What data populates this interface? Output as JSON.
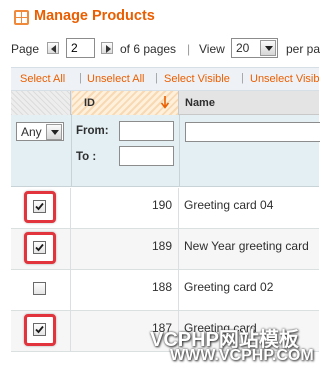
{
  "header": {
    "title": "Manage Products",
    "icon": "grid-icon"
  },
  "pager": {
    "page_label": "Page",
    "page_value": "2",
    "of_pages": "of 6 pages",
    "separator": "|",
    "view_label": "View",
    "limit_value": "20",
    "per_page": "per pa"
  },
  "massaction": {
    "select_all": "Select All",
    "unselect_all": "Unselect All",
    "select_visible": "Select Visible",
    "unselect_visible": "Unselect Visib",
    "separator": "|"
  },
  "grid": {
    "columns": {
      "id": "ID",
      "name": "Name"
    },
    "filters": {
      "any": "Any",
      "from": "From:",
      "to": "To :"
    },
    "rows": [
      {
        "id": "190",
        "name": "Greeting card 04",
        "checked": true,
        "highlighted": true
      },
      {
        "id": "189",
        "name": "New Year greeting card",
        "checked": true,
        "highlighted": true
      },
      {
        "id": "188",
        "name": "Greeting card 02",
        "checked": false,
        "highlighted": false
      },
      {
        "id": "187",
        "name": "Greeting card",
        "checked": true,
        "highlighted": true
      }
    ]
  },
  "watermark": {
    "line1": "VCPHP网站模板",
    "line2": "WWW.VCPHP.COM"
  },
  "colors": {
    "accent": "#eb5e00",
    "highlight": "#e1343d",
    "filter_bg": "#e3eff3"
  }
}
